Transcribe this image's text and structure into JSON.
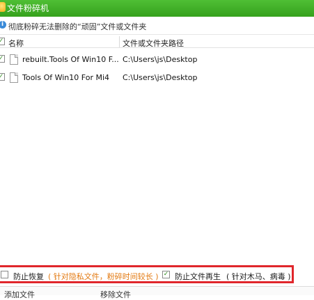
{
  "window": {
    "title": "文件粉碎机"
  },
  "info": {
    "text": "彻底粉碎无法删除的“顽固”文件或文件夹"
  },
  "table": {
    "headers": {
      "name": "名称",
      "path": "文件或文件夹路径"
    },
    "rows": [
      {
        "name": "rebuilt.Tools Of Win10 F...",
        "path": "C:\\Users\\js\\Desktop",
        "checked": true
      },
      {
        "name": "Tools Of Win10 For Mi4",
        "path": "C:\\Users\\js\\Desktop",
        "checked": true
      }
    ]
  },
  "options": {
    "prevent_recovery": {
      "label": "防止恢复",
      "hint": "( 针对隐私文件，粉碎时间较长 )",
      "checked": false
    },
    "prevent_regen": {
      "label": "防止文件再生",
      "hint": "( 针对木马、病毒 )",
      "checked": true
    }
  },
  "bottom": {
    "add_file": "添加文件",
    "remove_file": "移除文件"
  },
  "colors": {
    "title_green": "#35a11c",
    "highlight_red": "#e0262b",
    "hint_orange": "#e37a12"
  }
}
